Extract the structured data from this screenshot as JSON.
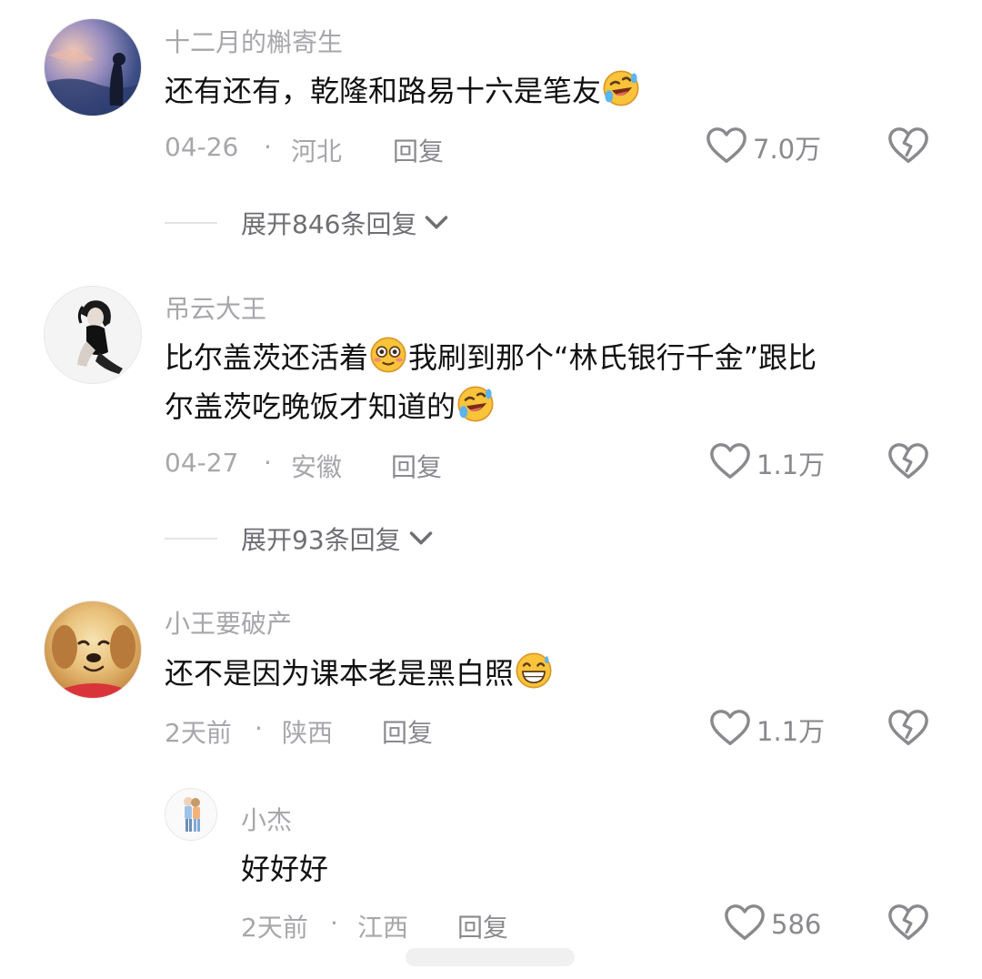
{
  "comments": [
    {
      "username": "十二月的槲寄生",
      "text": "还有还有，乾隆和路易十六是笔友",
      "emoji": "rofl-emoji",
      "date": "04-26",
      "separator": "·",
      "location": "河北",
      "reply_label": "回复",
      "like_count": "7.0万",
      "expand_label": "展开846条回复"
    },
    {
      "username": "吊云大王",
      "text_line1": "比尔盖茨还活着",
      "emoji1": "flushed-emoji",
      "text_line1b": "我刷到那个“林氏银行千金”跟比",
      "text_line2": "尔盖茨吃晚饭才知道的",
      "emoji2": "rofl-emoji",
      "date": "04-27",
      "separator": "·",
      "location": "安徽",
      "reply_label": "回复",
      "like_count": "1.1万",
      "expand_label": "展开93条回复"
    },
    {
      "username": "小王要破产",
      "text": "还不是因为课本老是黑白照",
      "emoji": "grin-sweat-emoji",
      "date": "2天前",
      "separator": "·",
      "location": "陕西",
      "reply_label": "回复",
      "like_count": "1.1万",
      "reply": {
        "username": "小杰",
        "text": "好好好",
        "date": "2天前",
        "separator": "·",
        "location": "江西",
        "reply_label": "回复",
        "like_count": "586"
      }
    }
  ],
  "colors": {
    "meta_gray": "#a7a7ab",
    "action_gray": "#8a8a8e",
    "text": "#111111"
  },
  "icons": [
    "heart-icon",
    "broken-heart-icon",
    "chevron-down-icon"
  ]
}
